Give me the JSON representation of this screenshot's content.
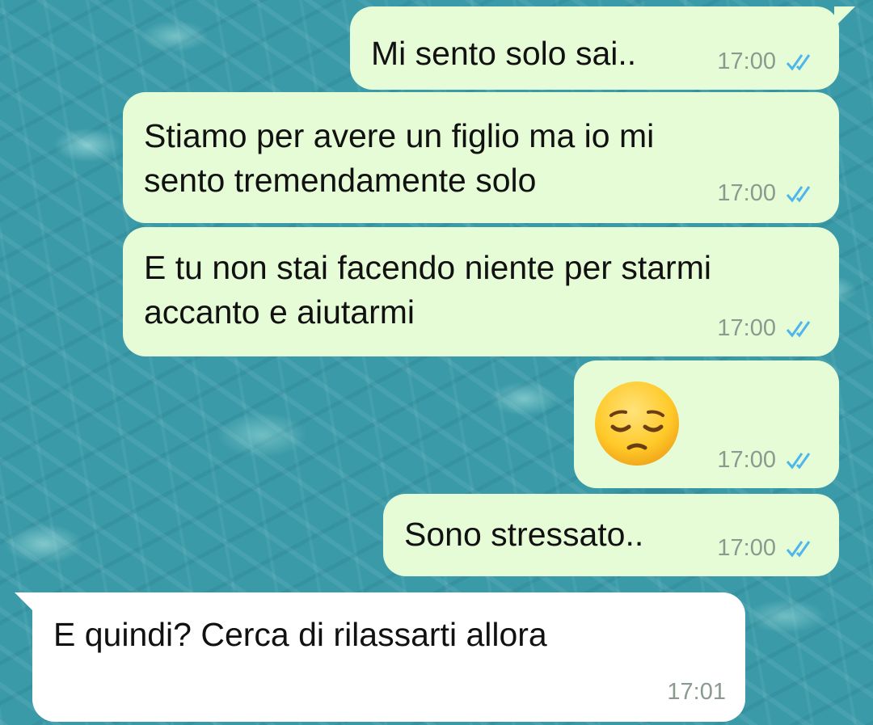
{
  "messages": [
    {
      "text": "Mi sento solo sai..",
      "time": "17:00",
      "status": "read"
    },
    {
      "text": "Stiamo per avere un figlio ma io mi\nsento tremendamente solo",
      "line1": "Stiamo per avere un figlio ma io mi",
      "line2": "sento tremendamente solo",
      "time": "17:00",
      "status": "read"
    },
    {
      "line1": "E tu non stai facendo niente per starmi",
      "line2": "accanto e aiutarmi",
      "time": "17:00",
      "status": "read"
    },
    {
      "emoji": "pensive-face",
      "time": "17:00",
      "status": "read"
    },
    {
      "text": "Sono stressato..",
      "time": "17:00",
      "status": "read"
    },
    {
      "text": "E quindi? Cerca di rilassarti allora",
      "time": "17:01"
    }
  ],
  "colors": {
    "outgoing_bubble": "#e6fcd6",
    "incoming_bubble": "#ffffff",
    "read_ticks": "#4fb6ec",
    "timestamp": "#8a9a8f"
  },
  "icons": [
    "double-check-icon",
    "pensive-face-emoji"
  ]
}
